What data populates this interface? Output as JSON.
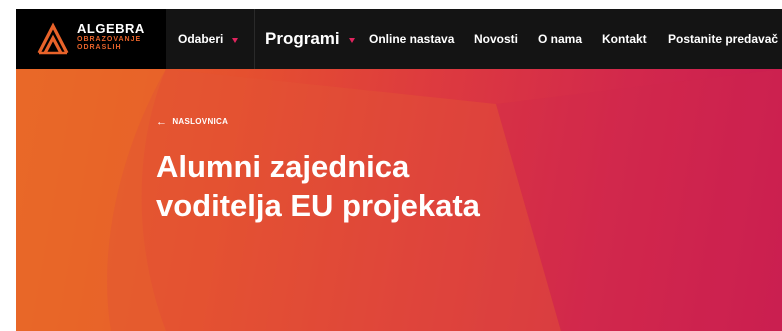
{
  "logo": {
    "title": "ALGEBRA",
    "subtitle_line1": "OBRAZOVANJE",
    "subtitle_line2": "ODRASLIH",
    "icon": "algebra-logo-icon"
  },
  "nav": {
    "items": [
      {
        "label": "Odaberi",
        "dropdown": true
      },
      {
        "label": "Programi",
        "dropdown": true
      },
      {
        "label": "Online nastava"
      },
      {
        "label": "Novosti"
      },
      {
        "label": "O nama"
      },
      {
        "label": "Kontakt"
      },
      {
        "label": "Postanite predavač"
      }
    ]
  },
  "hero": {
    "back_label": "NASLOVNICA",
    "back_icon": "arrow-left-icon",
    "title": "Alumni zajednica voditelja EU projekata"
  },
  "colors": {
    "nav_background": "#141414",
    "logo_background": "#000000",
    "accent_orange": "#e8632a",
    "caret_pink": "#e0245e",
    "hero_gradient_start": "#e8642a",
    "hero_gradient_end": "#c91c52"
  }
}
